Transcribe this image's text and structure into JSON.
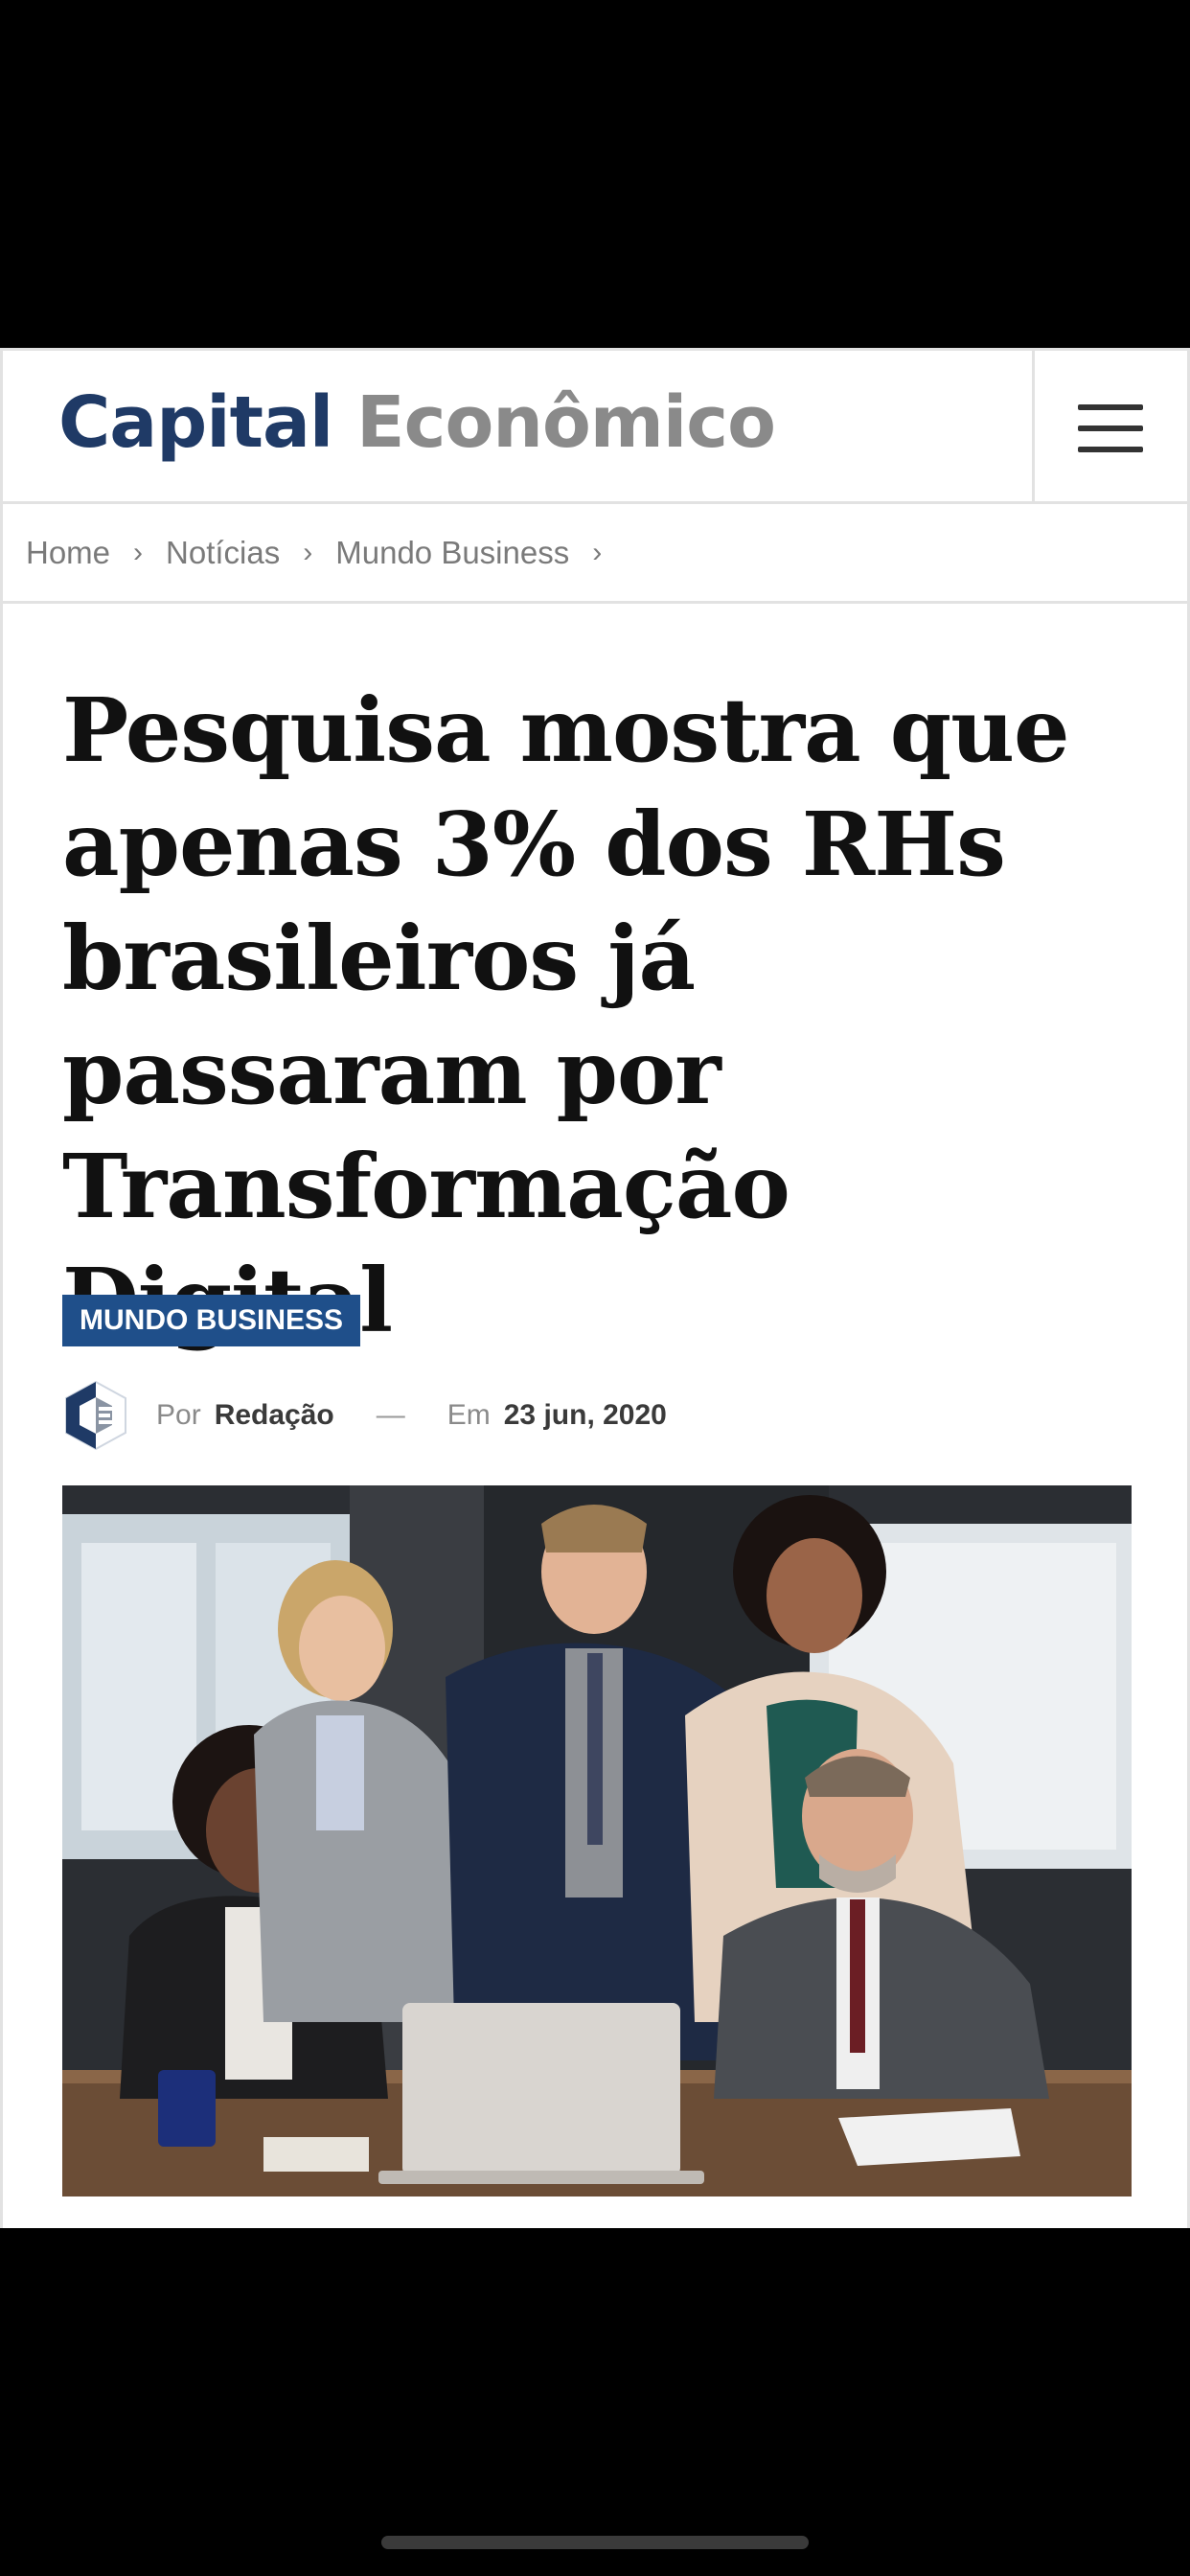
{
  "header": {
    "logo_part1": "Capital",
    "logo_part2": "Econômico",
    "menu_icon": "hamburger-menu-icon"
  },
  "breadcrumb": {
    "items": [
      "Home",
      "Notícias",
      "Mundo Business"
    ],
    "separator": "›"
  },
  "article": {
    "title": "Pesquisa mostra que apenas 3% dos RHs brasileiros já passaram por Transformação Digital",
    "category": "MUNDO BUSINESS",
    "author_prefix": "Por",
    "author": "Redação",
    "date_prefix": "Em",
    "date": "23 jun, 2020",
    "dash": "—"
  },
  "colors": {
    "brand_blue": "#1f3a66",
    "category_bg": "#1f4f8a",
    "logo_gray": "#8a8a8a"
  }
}
